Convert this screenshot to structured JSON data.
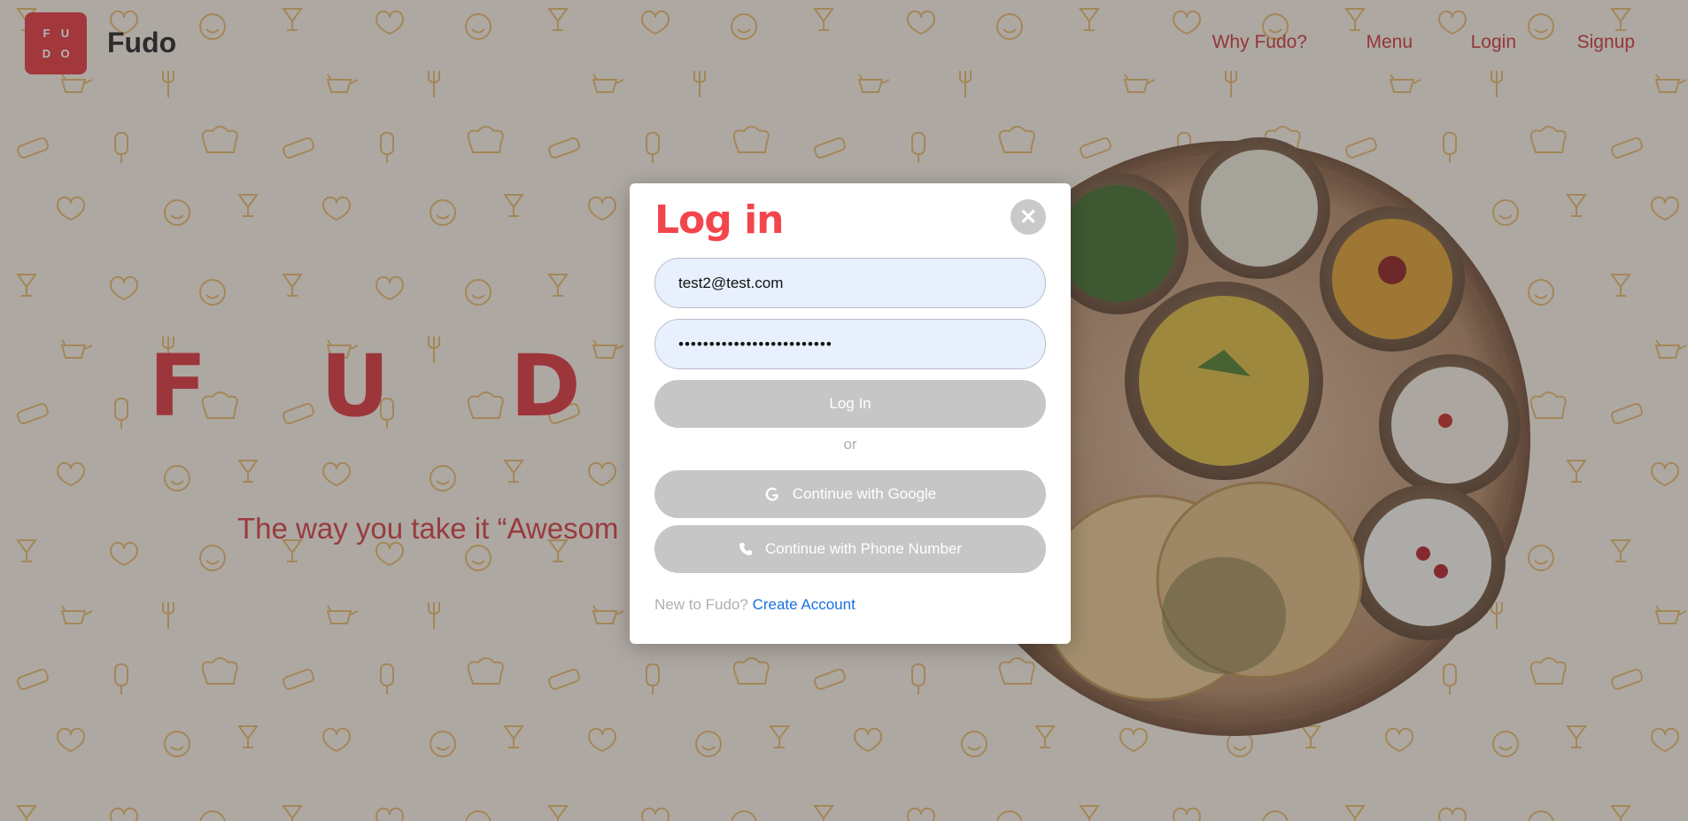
{
  "header": {
    "logo_letters": [
      "F",
      "U",
      "D",
      "O"
    ],
    "brand": "Fudo",
    "nav": [
      "Why Fudo?",
      "Menu",
      "Login",
      "Signup"
    ]
  },
  "hero": {
    "letters": [
      "F",
      "U",
      "D"
    ],
    "tagline": "The way you take it “Awesom"
  },
  "modal": {
    "title": "Log in",
    "close_icon": "close-icon",
    "email_value": "test2@test.com",
    "password_value": "•••••••••••••••••••••••••",
    "login_label": "Log In",
    "or_label": "or",
    "google_label": "Continue with Google",
    "google_icon": "google-icon",
    "phone_label": "Continue with Phone Number",
    "phone_icon": "phone-icon",
    "footer_prompt": "New to Fudo?",
    "footer_link": "Create Account"
  },
  "colors": {
    "brand_red": "#e1343d",
    "title_red": "#f3454c",
    "link_blue": "#1b6fe0",
    "button_gray": "#c6c6c6",
    "input_bg": "#e8f0fe"
  }
}
